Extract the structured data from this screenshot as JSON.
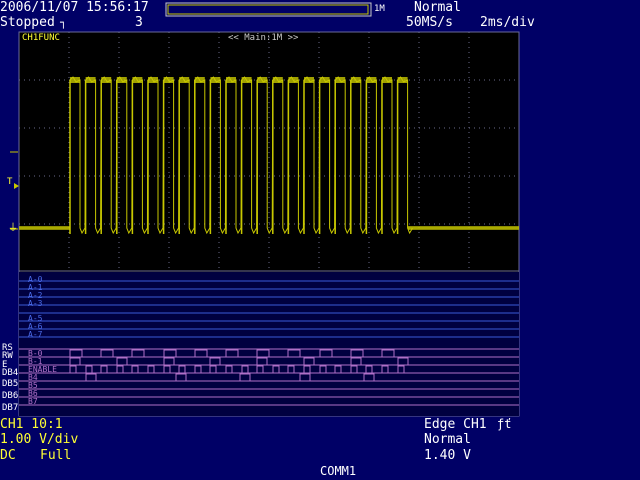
{
  "header": {
    "datetime": "2006/11/07 15:56:17",
    "run_state": "Stopped",
    "run_state_icon": "trigger-stopped-icon",
    "acq_count": "3",
    "record_length": "1M",
    "trigger_mode": "Normal",
    "sample_rate": "50MS/s",
    "timebase": "2ms/div"
  },
  "waveform": {
    "label": "CH1FUNC",
    "zoom_label": "<< Main:1M >>",
    "color": "#c8c800",
    "trigger_marker": "T",
    "ground_marker": "⏚"
  },
  "logic": {
    "group_a_labels": [
      "A-0",
      "A-1",
      "A-2",
      "A-3",
      "A-5",
      "A-6",
      "A-7"
    ],
    "group_b_labels": [
      "B-0",
      "B-1",
      "ENABLE",
      "B4",
      "B5",
      "B6",
      "B7"
    ],
    "left_labels": [
      "RS",
      "RW",
      "E",
      "DB4",
      "DB5",
      "DB6",
      "DB7"
    ],
    "line_color_a": "#3a5ad8",
    "line_color_b": "#b070c8"
  },
  "footer": {
    "ch1_probe": "CH1 10:1",
    "ch1_scale": "1.00 V/div",
    "ch1_coupling": "DC",
    "ch1_bandwidth": "Full",
    "trigger_type": "Edge CH1",
    "trigger_slope_icon": "rising-falling-edge-icon",
    "trigger_mode": "Normal",
    "trigger_level": "1.40 V",
    "comm": "COMM1"
  }
}
